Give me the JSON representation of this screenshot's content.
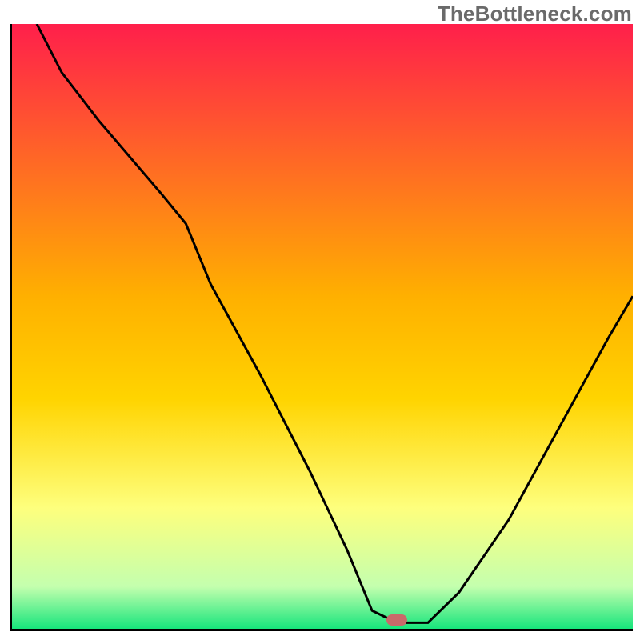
{
  "watermark": "TheBottleneck.com",
  "colors": {
    "top_red": "#ff1f4b",
    "yellow": "#ffd400",
    "pale_yellow": "#feff7d",
    "green": "#17e57c",
    "curve": "#000000",
    "marker": "#c96a6a"
  },
  "chart_data": {
    "type": "line",
    "title": "",
    "xlabel": "",
    "ylabel": "",
    "xlim": [
      0,
      100
    ],
    "ylim": [
      0,
      100
    ],
    "marker": {
      "x": 62,
      "y": 1.5
    },
    "series": [
      {
        "name": "bottleneck-curve",
        "x": [
          4,
          8,
          14,
          24,
          28,
          32,
          40,
          48,
          54,
          58,
          62,
          67,
          72,
          80,
          88,
          96,
          100
        ],
        "y": [
          100,
          92,
          84,
          72,
          67,
          57,
          42,
          26,
          13,
          3,
          1,
          1,
          6,
          18,
          33,
          48,
          55
        ]
      }
    ],
    "background_gradient": {
      "stops": [
        {
          "offset": 0,
          "color": "#ff1f4b"
        },
        {
          "offset": 45,
          "color": "#ffb000"
        },
        {
          "offset": 62,
          "color": "#ffd400"
        },
        {
          "offset": 80,
          "color": "#feff7d"
        },
        {
          "offset": 93,
          "color": "#c4ffae"
        },
        {
          "offset": 100,
          "color": "#17e57c"
        }
      ]
    }
  }
}
